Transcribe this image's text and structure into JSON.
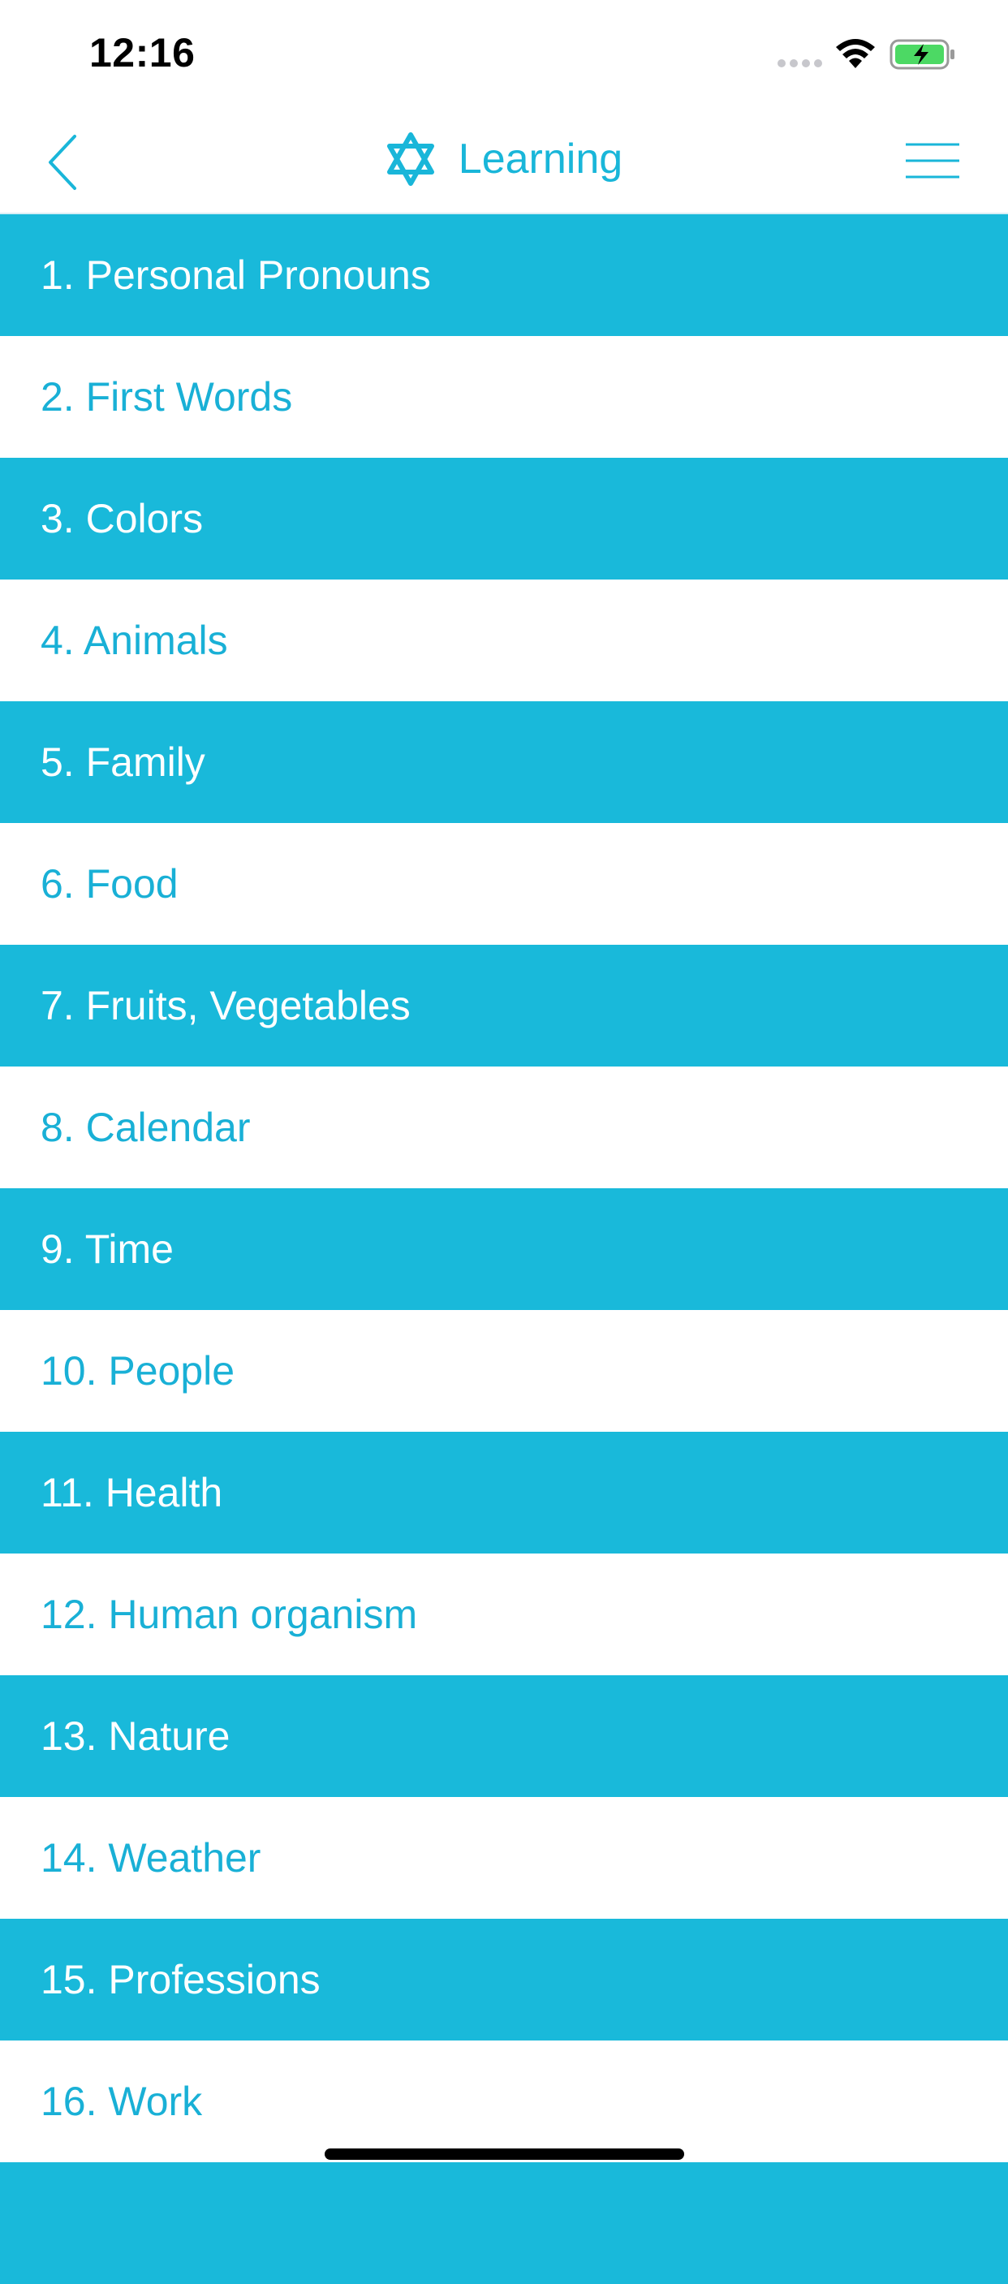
{
  "status_bar": {
    "time": "12:16"
  },
  "nav": {
    "title": "Learning",
    "icons": {
      "back": "chevron-left-icon",
      "logo": "star-of-david-icon",
      "menu": "hamburger-menu-icon"
    }
  },
  "colors": {
    "accent": "#19b9da",
    "text_accent": "#19b0d6",
    "row_alt": "#ffffff"
  },
  "lessons": [
    {
      "label": "1. Personal Pronouns"
    },
    {
      "label": "2. First Words"
    },
    {
      "label": "3. Colors"
    },
    {
      "label": "4. Animals"
    },
    {
      "label": "5. Family"
    },
    {
      "label": "6. Food"
    },
    {
      "label": "7. Fruits, Vegetables"
    },
    {
      "label": "8. Calendar"
    },
    {
      "label": "9. Time"
    },
    {
      "label": "10. People"
    },
    {
      "label": "11. Health"
    },
    {
      "label": "12. Human organism"
    },
    {
      "label": "13. Nature"
    },
    {
      "label": "14. Weather"
    },
    {
      "label": "15. Professions"
    },
    {
      "label": "16. Work"
    },
    {
      "label": ""
    }
  ]
}
